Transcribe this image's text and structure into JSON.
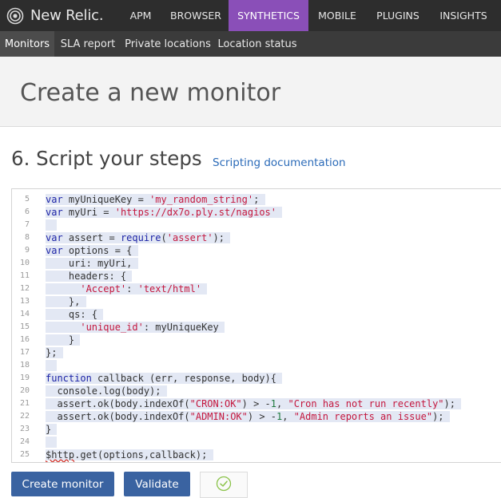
{
  "app": {
    "brand": "New Relic."
  },
  "topnav": [
    {
      "label": "APM"
    },
    {
      "label": "BROWSER"
    },
    {
      "label": "SYNTHETICS"
    },
    {
      "label": "MOBILE"
    },
    {
      "label": "PLUGINS"
    },
    {
      "label": "INSIGHTS"
    }
  ],
  "subnav": [
    {
      "label": "Monitors"
    },
    {
      "label": "SLA report"
    },
    {
      "label": "Private locations"
    },
    {
      "label": "Location status"
    }
  ],
  "page": {
    "title": "Create a new monitor",
    "section_title": "6. Script your steps",
    "docs_link": "Scripting documentation"
  },
  "editor": {
    "lines": [
      {
        "n": "5",
        "t": [
          [
            "kw",
            "var"
          ],
          [
            "p",
            " myUniqueKey = "
          ],
          [
            "str",
            "'my_random_string'"
          ],
          [
            "p",
            ";"
          ]
        ]
      },
      {
        "n": "6",
        "t": [
          [
            "kw",
            "var"
          ],
          [
            "p",
            " myUri = "
          ],
          [
            "str",
            "'https://dx7o.ply.st/nagios'"
          ]
        ]
      },
      {
        "n": "7",
        "t": []
      },
      {
        "n": "8",
        "t": [
          [
            "kw",
            "var"
          ],
          [
            "p",
            " assert = "
          ],
          [
            "kw",
            "require"
          ],
          [
            "p",
            "("
          ],
          [
            "str",
            "'assert'"
          ],
          [
            "p",
            ");"
          ]
        ]
      },
      {
        "n": "9",
        "t": [
          [
            "kw",
            "var"
          ],
          [
            "p",
            " options = {"
          ]
        ]
      },
      {
        "n": "10",
        "t": [
          [
            "p",
            "    uri: myUri,"
          ]
        ]
      },
      {
        "n": "11",
        "t": [
          [
            "p",
            "    headers: {"
          ]
        ]
      },
      {
        "n": "12",
        "t": [
          [
            "p",
            "      "
          ],
          [
            "str",
            "'Accept'"
          ],
          [
            "p",
            ": "
          ],
          [
            "str",
            "'text/html'"
          ]
        ]
      },
      {
        "n": "13",
        "t": [
          [
            "p",
            "    },"
          ]
        ]
      },
      {
        "n": "14",
        "t": [
          [
            "p",
            "    qs: {"
          ]
        ]
      },
      {
        "n": "15",
        "t": [
          [
            "p",
            "      "
          ],
          [
            "str",
            "'unique_id'"
          ],
          [
            "p",
            ": myUniqueKey"
          ]
        ]
      },
      {
        "n": "16",
        "t": [
          [
            "p",
            "    }"
          ]
        ]
      },
      {
        "n": "17",
        "t": [
          [
            "p",
            "};"
          ]
        ]
      },
      {
        "n": "18",
        "t": []
      },
      {
        "n": "19",
        "t": [
          [
            "kw",
            "function"
          ],
          [
            "p",
            " callback (err, response, body){"
          ]
        ]
      },
      {
        "n": "20",
        "t": [
          [
            "p",
            "  console.log(body);"
          ]
        ]
      },
      {
        "n": "21",
        "t": [
          [
            "p",
            "  assert.ok(body.indexOf("
          ],
          [
            "str",
            "\"CRON:OK\""
          ],
          [
            "p",
            ") > -"
          ],
          [
            "num",
            "1"
          ],
          [
            "p",
            ", "
          ],
          [
            "str",
            "\"Cron has not run recently\""
          ],
          [
            "p",
            ");"
          ]
        ]
      },
      {
        "n": "22",
        "t": [
          [
            "p",
            "  assert.ok(body.indexOf("
          ],
          [
            "str",
            "\"ADMIN:OK\""
          ],
          [
            "p",
            ") > -"
          ],
          [
            "num",
            "1"
          ],
          [
            "p",
            ", "
          ],
          [
            "str",
            "\"Admin reports an issue\""
          ],
          [
            "p",
            ");"
          ]
        ]
      },
      {
        "n": "23",
        "t": [
          [
            "p",
            "}"
          ]
        ]
      },
      {
        "n": "24",
        "t": []
      },
      {
        "n": "25",
        "t": [
          [
            "sq",
            "$http"
          ],
          [
            "p",
            ".get(options,callback);"
          ]
        ]
      }
    ]
  },
  "actions": {
    "create_label": "Create monitor",
    "validate_label": "Validate",
    "status_icon": "check-circle-icon"
  },
  "colors": {
    "topbar": "#2d2d2d",
    "active_tab": "#8a4fb8",
    "button": "#3a63a1",
    "link": "#2a6ab8",
    "check": "#8bc34a"
  }
}
